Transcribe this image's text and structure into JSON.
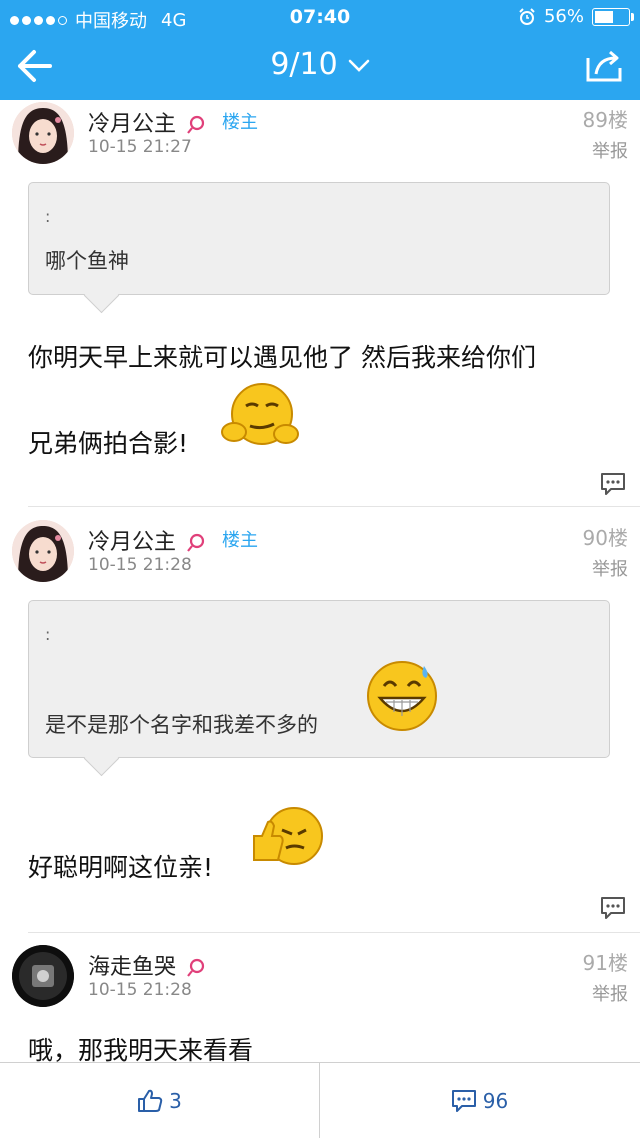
{
  "status_bar": {
    "carrier": "中国移动",
    "network": "4G",
    "time": "07:40",
    "battery": "56%",
    "battery_level": 0.56,
    "signal_bars": 4
  },
  "nav": {
    "page": "9/10"
  },
  "posts": [
    {
      "username": "冷月公主",
      "role": "楼主",
      "time": "10-15 21:27",
      "floor": "89楼",
      "report": "举报",
      "quote_colon": ":",
      "quote_text": "哪个鱼神",
      "text_line1": "你明天早上来就可以遇见他了 然后我来给你们",
      "text_line2": "兄弟俩拍合影!"
    },
    {
      "username": "冷月公主",
      "role": "楼主",
      "time": "10-15 21:28",
      "floor": "90楼",
      "report": "举报",
      "quote_colon": ":",
      "quote_text": "是不是那个名字和我差不多的",
      "text_line1": "好聪明啊这位亲!"
    },
    {
      "username": "海走鱼哭",
      "time": "10-15 21:28",
      "floor": "91楼",
      "report": "举报",
      "text_line1": "哦，那我明天来看看"
    }
  ],
  "bottom": {
    "likes": "3",
    "comments": "96"
  },
  "colors": {
    "accent": "#2ba6f0",
    "gender_female": "#e0407a",
    "bottom_text": "#2a5fa8"
  }
}
